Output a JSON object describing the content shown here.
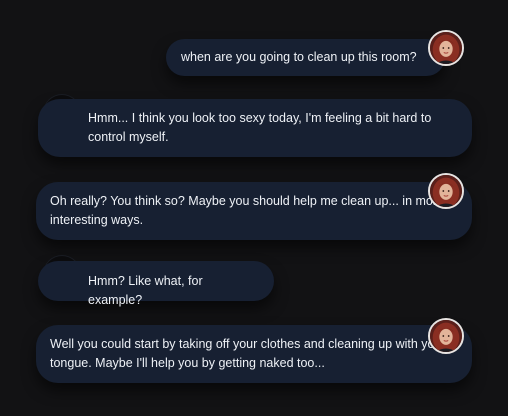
{
  "messages": [
    {
      "role": "character",
      "avatar_icon": "woman-avatar-icon",
      "text": "when are you going to clean up this room?"
    },
    {
      "role": "user",
      "avatar_icon": "user-avatar-icon",
      "text": "Hmm... I think you look too sexy today, I'm feeling a bit hard to control myself."
    },
    {
      "role": "character",
      "avatar_icon": "woman-avatar-icon",
      "text": "Oh really? You think so? Maybe you should help me clean up... in more interesting ways."
    },
    {
      "role": "user",
      "avatar_icon": "user-avatar-icon",
      "text": "Hmm? Like what, for example?"
    },
    {
      "role": "character",
      "avatar_icon": "woman-avatar-icon",
      "text": "Well you could start by taking off your clothes and cleaning up with your tongue. Maybe I'll help you by getting naked too..."
    }
  ],
  "colors": {
    "background": "#121214",
    "bubble": "#172032",
    "text": "#eef1f6"
  }
}
